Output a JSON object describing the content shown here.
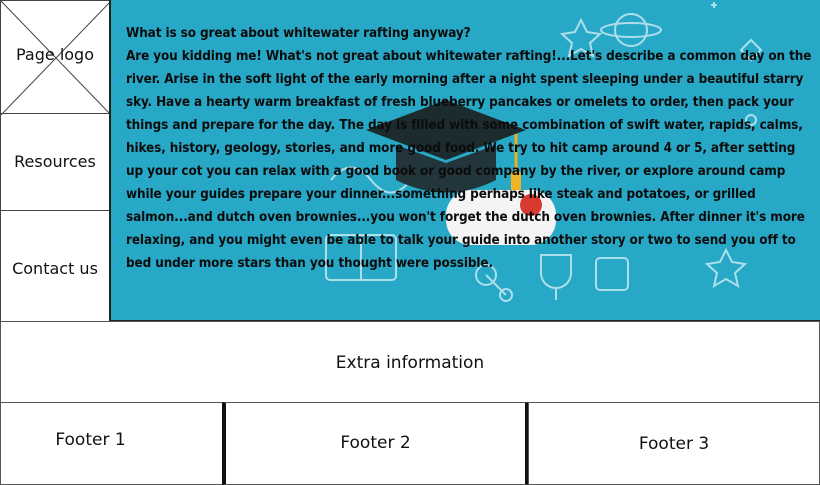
{
  "sidebar": {
    "logo_label": "Page logo",
    "items": [
      {
        "label": "Resources"
      },
      {
        "label": "Contact us"
      }
    ]
  },
  "main": {
    "heading": "What is so great about whitewater rafting anyway?",
    "body": "Are you kidding me! What's not great about whitewater rafting!...Let's describe a common day on the river. Arise in the soft light of the early morning after a night spent sleeping under a beautiful starry sky. Have a hearty warm breakfast of fresh blueberry pancakes or omelets to order, then pack your things and prepare for the day. The day is filled with some combination of swift water, rapids, calms, hikes, history, geology, stories, and more good food. We try to hit camp around 4 or 5, after setting up your cot you can relax with a good book or good company by the river, or explore around camp while your guides prepare your dinner...something perhaps like steak and potatoes, or grilled salmon...and dutch oven brownies...you won't forget the dutch oven brownies. After dinner it's more relaxing, and you might even be able to talk your guide into another story or two to send you off to bed under more stars than you thought were possible.",
    "background_color": "#27a8c6"
  },
  "extra": {
    "label": "Extra information"
  },
  "footer": {
    "items": [
      {
        "label": "Footer 1"
      },
      {
        "label": "Footer 2"
      },
      {
        "label": "Footer 3"
      }
    ]
  }
}
